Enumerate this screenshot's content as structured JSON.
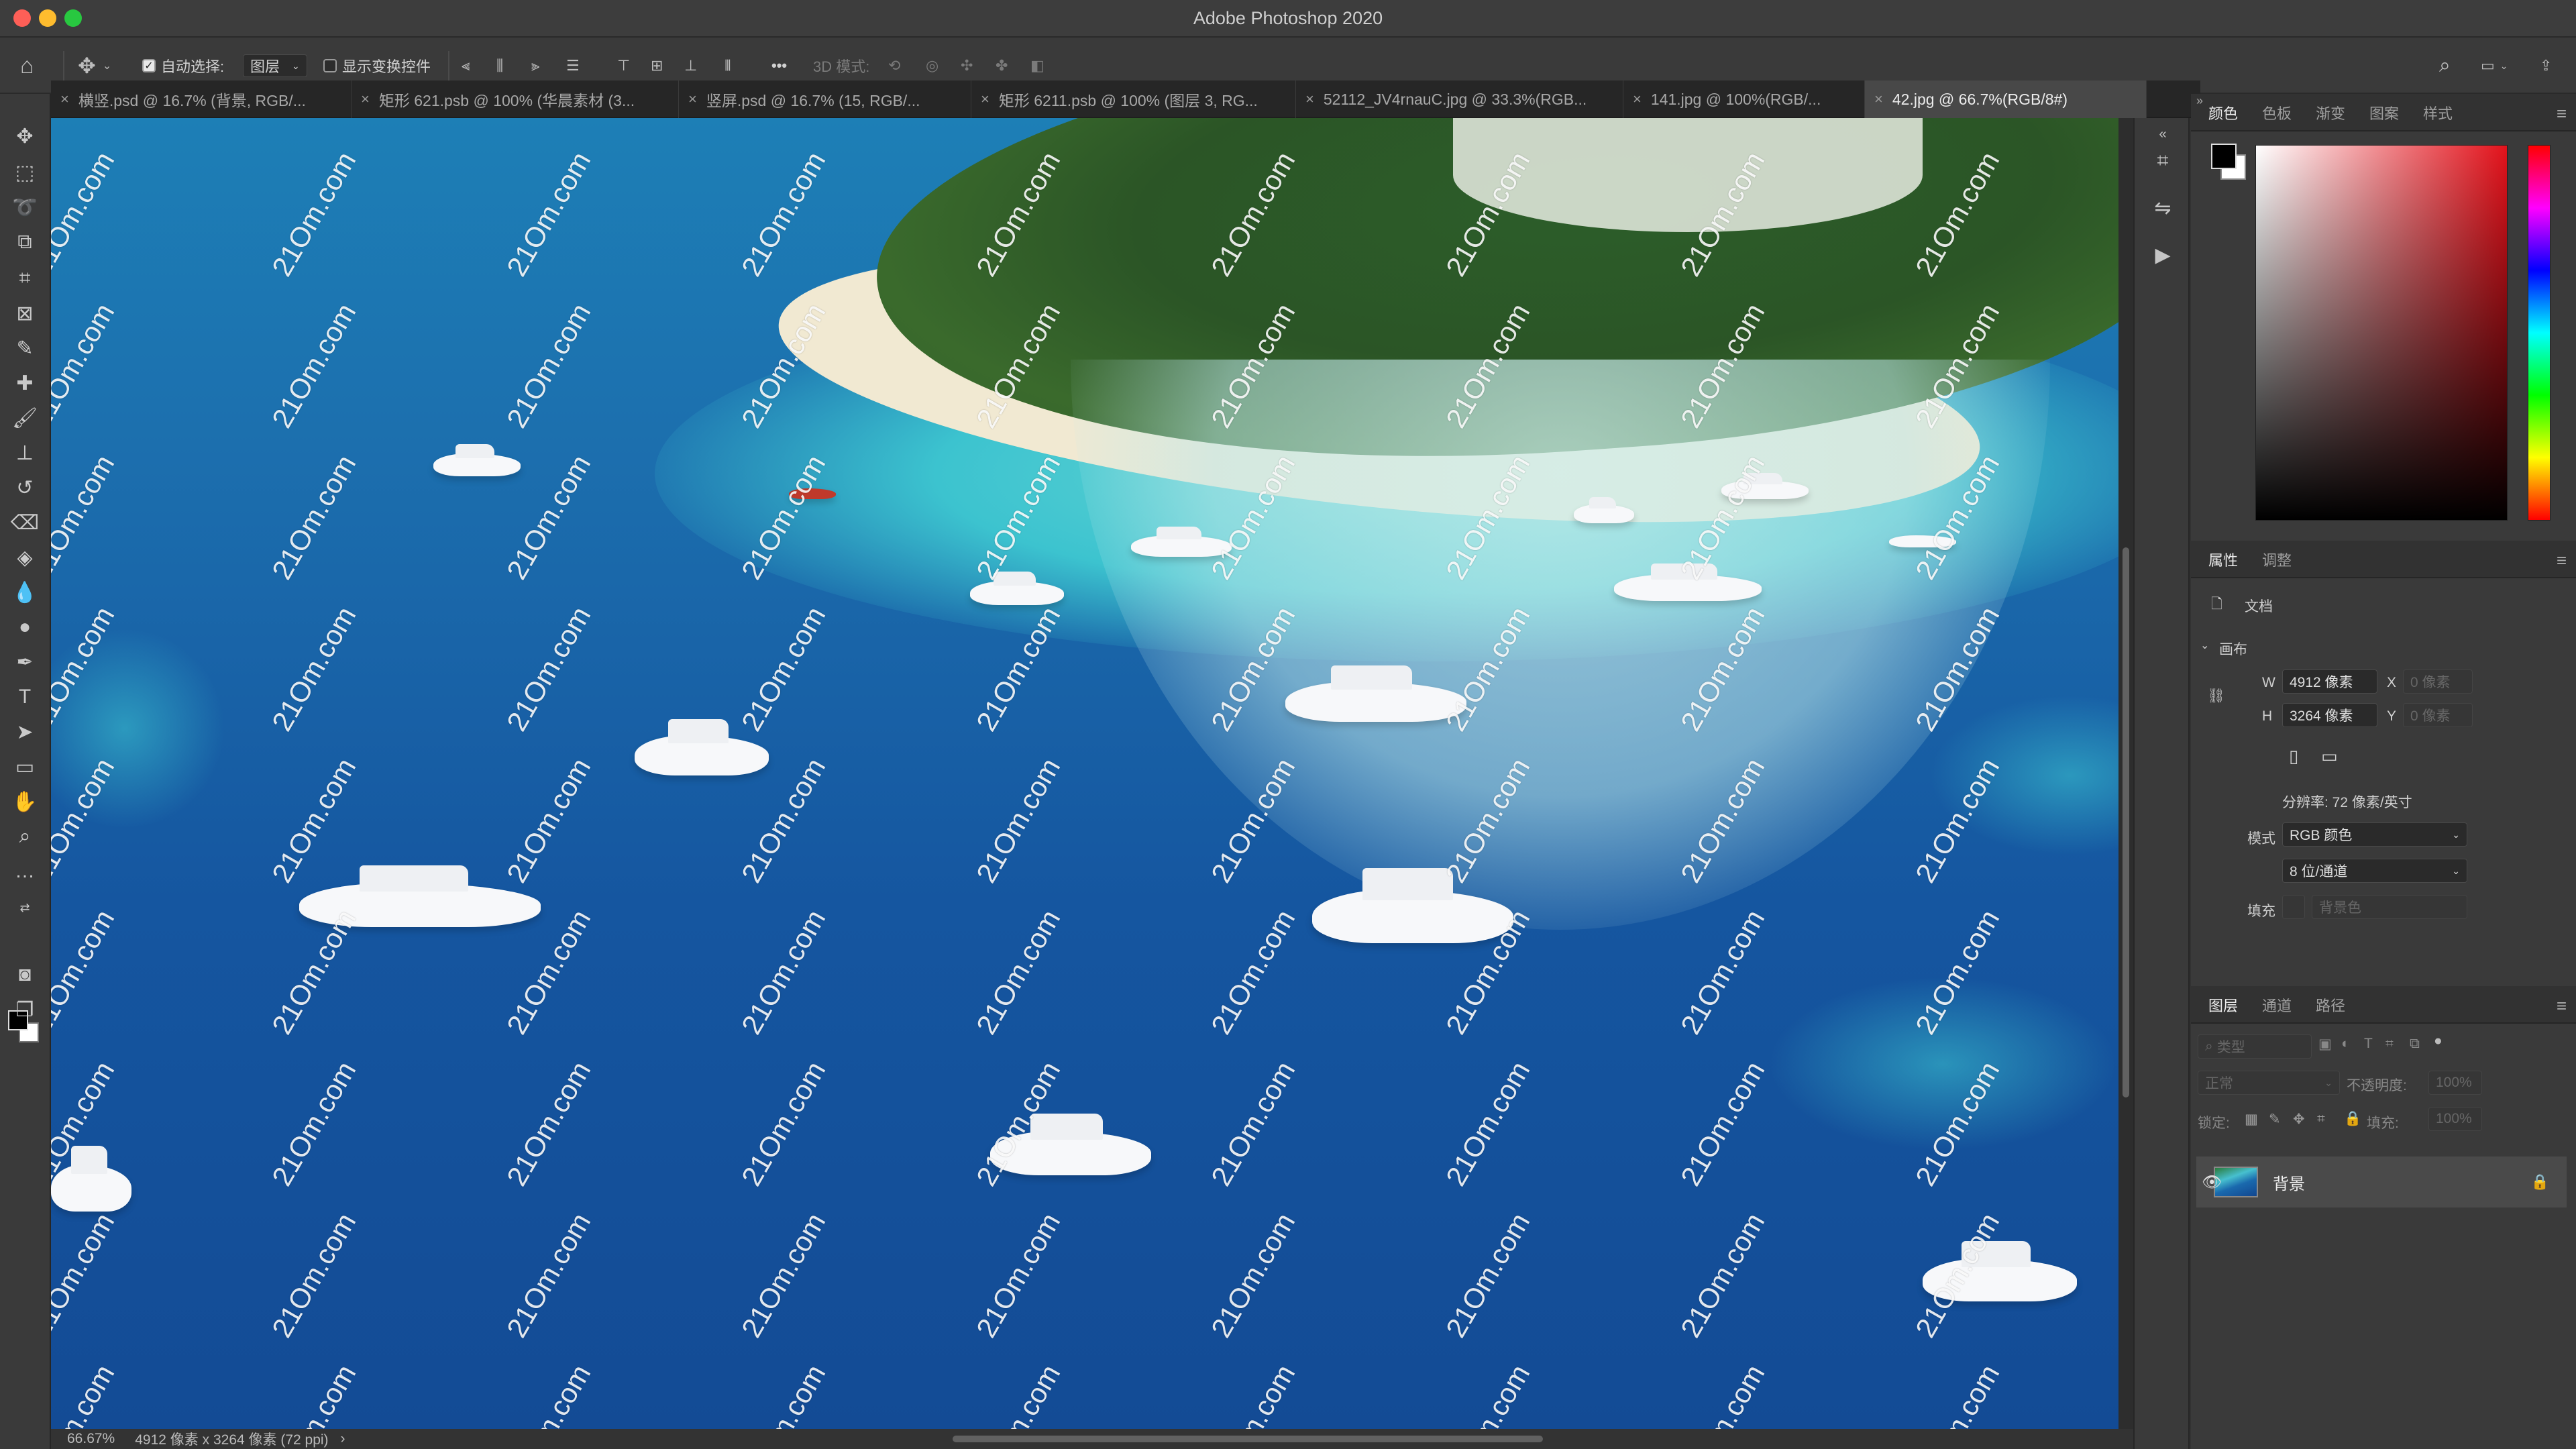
{
  "window": {
    "title": "Adobe Photoshop 2020"
  },
  "options_bar": {
    "auto_select_label": "自动选择:",
    "auto_select_value": "图层",
    "show_transform_label": "显示变换控件",
    "mode_3d_label": "3D 模式:",
    "more_label": "•••"
  },
  "tabs": [
    {
      "label": "横竖.psd @ 16.7% (背景, RGB/..."
    },
    {
      "label": "矩形 621.psb @ 100% (华晨素材 (3..."
    },
    {
      "label": "竖屏.psd @ 16.7% (15, RGB/..."
    },
    {
      "label": "矩形 6211.psb @ 100% (图层 3, RG..."
    },
    {
      "label": "52112_JV4rnauC.jpg @ 33.3%(RGB..."
    },
    {
      "label": "141.jpg @ 100%(RGB/..."
    },
    {
      "label": "42.jpg @ 66.7%(RGB/8#)"
    }
  ],
  "status_bar": {
    "zoom": "66.67%",
    "doc_info": "4912 像素 x 3264 像素 (72 ppi)"
  },
  "watermark_text": "21Om.com",
  "color_panel": {
    "tabs": [
      "颜色",
      "色板",
      "渐变",
      "图案",
      "样式"
    ],
    "foreground": "#000000",
    "background": "#ffffff"
  },
  "properties_panel": {
    "tabs": [
      "属性",
      "调整"
    ],
    "doc_label": "文档",
    "canvas_label": "画布",
    "w_label": "W",
    "w_value": "4912 像素",
    "h_label": "H",
    "h_value": "3264 像素",
    "x_label": "X",
    "x_value": "0 像素",
    "y_label": "Y",
    "y_value": "0 像素",
    "resolution": "分辨率: 72 像素/英寸",
    "mode_label": "模式",
    "mode_value": "RGB 颜色",
    "depth_value": "8 位/通道",
    "fill_label": "填充",
    "fill_value": "背景色"
  },
  "layers_panel": {
    "tabs": [
      "图层",
      "通道",
      "路径"
    ],
    "search_placeholder": "类型",
    "blend_mode": "正常",
    "opacity_label": "不透明度:",
    "opacity_value": "100%",
    "lock_label": "锁定:",
    "fill_label": "填充:",
    "fill_value": "100%",
    "layers": [
      {
        "name": "背景",
        "visible": true,
        "locked": true
      }
    ]
  },
  "colors": {
    "accent_red": "#e3121b",
    "panel_bg": "#3a3a3a",
    "canvas_blue": "#1556a0"
  }
}
